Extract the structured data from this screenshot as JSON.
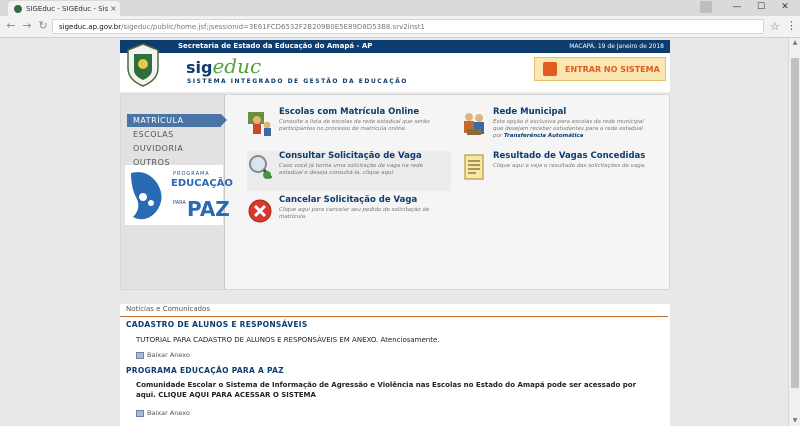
{
  "browser": {
    "tab_title": "SIGEduc - SIGEduc - Sis",
    "tab_close": "×",
    "url_host": "sigeduc.ap.gov.br",
    "url_path": "/sigeduc/public/home.jsf;jsessionid=3E61FCD6532F2B209B0E5E89D8D53B8.srv2inst1",
    "controls": {
      "minimize": "—",
      "maximize": "☐",
      "close": "✕"
    }
  },
  "header": {
    "secretaria": "Secretaria de Estado da Educação do Amapá - AP",
    "date": "MACAPÁ, 19 de Janeiro de 2018",
    "logo_sig": "sig",
    "logo_educ": "educ",
    "logo_subtitle": "SISTEMA INTEGRADO DE GESTÃO DA EDUCAÇÃO",
    "login_label": "ENTRAR NO SISTEMA"
  },
  "sidebar": {
    "items": [
      {
        "label": "MATRÍCULA",
        "active": true
      },
      {
        "label": "ESCOLAS",
        "active": false
      },
      {
        "label": "OUVIDORIA",
        "active": false
      },
      {
        "label": "OUTROS",
        "active": false
      }
    ],
    "banner": {
      "small": "PROGRAMA",
      "big": "EDUCAÇÃO",
      "para": "PARA",
      "paz": "PAZ"
    }
  },
  "options": [
    {
      "title": "Escolas com Matrícula Online",
      "desc": "Consulte a lista de escolas da rede estadual que serão participantes no processo de matrícula online."
    },
    {
      "title": "Rede Municipal",
      "desc": "Esta opção é exclusiva para escolas da rede municipal que desejam receber estudantes para a rede estadual por",
      "accent": "Transferência Automática"
    },
    {
      "title": "Consultar Solicitação de Vaga",
      "desc": "Caso você já tenha uma solicitação de vaga na rede estadual e deseja consultá-la, clique aqui."
    },
    {
      "title": "Resultado de Vagas Concedidas",
      "desc": "Clique aqui e veja o resultado das solicitações de vaga."
    },
    {
      "title": "Cancelar Solicitação de Vaga",
      "desc": "Clique aqui para cancelar seu pedido de solicitação de matrícula."
    }
  ],
  "news": {
    "heading": "Notícias e Comunicados",
    "items": [
      {
        "title": "CADASTRO DE ALUNOS E RESPONSÁVEIS",
        "text": "TUTORIAL PARA CADASTRO DE ALUNOS E RESPONSÁVEIS EM ANEXO. Atenciosamente.",
        "attach": "Baixar Anexo"
      },
      {
        "title": "PROGRAMA EDUCAÇÃO PARA A PAZ",
        "text": "Comunidade Escolar o Sistema de Informação de Agressão e Violência nas Escolas no Estado do Amapá pode ser acessado por aqui. CLIQUE AQUI PARA ACESSAR O SISTEMA",
        "attach": "Baixar Anexo"
      }
    ]
  },
  "colors": {
    "brand_navy": "#0d3c6e",
    "brand_green": "#4fa33b",
    "accent_orange": "#e25b1f"
  }
}
